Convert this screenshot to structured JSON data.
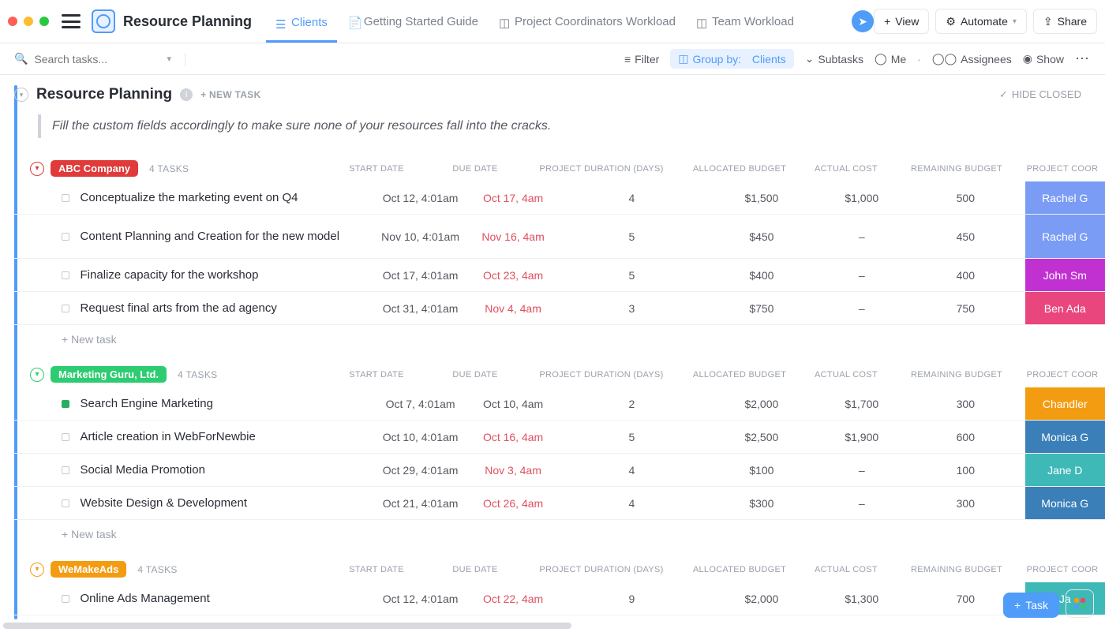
{
  "header": {
    "page_title": "Resource Planning",
    "tabs": [
      {
        "label": "Clients",
        "active": true
      },
      {
        "label": "Getting Started Guide",
        "active": false
      },
      {
        "label": "Project Coordinators Workload",
        "active": false
      },
      {
        "label": "Team Workload",
        "active": false
      }
    ],
    "add_view_label": "View",
    "automate_label": "Automate",
    "share_label": "Share"
  },
  "toolbar": {
    "search_placeholder": "Search tasks...",
    "filter_label": "Filter",
    "group_by_prefix": "Group by:",
    "group_by_value": "Clients",
    "subtasks_label": "Subtasks",
    "me_label": "Me",
    "assignees_label": "Assignees",
    "show_label": "Show"
  },
  "view": {
    "title": "Resource Planning",
    "new_task_label": "+ NEW TASK",
    "hide_closed_label": "HIDE CLOSED",
    "description": "Fill the custom fields accordingly to make sure none of your resources fall into the cracks.",
    "columns": {
      "start": "START DATE",
      "due": "DUE DATE",
      "duration": "PROJECT DURATION (DAYS)",
      "alloc": "ALLOCATED BUDGET",
      "actual": "ACTUAL COST",
      "remain": "REMAINING BUDGET",
      "coord": "PROJECT COOR"
    },
    "new_task_row": "+ New task"
  },
  "groups": [
    {
      "name": "ABC Company",
      "color": "#e03a3a",
      "count": "4 TASKS",
      "tasks": [
        {
          "name": "Conceptualize the marketing event on Q4",
          "start": "Oct 12, 4:01am",
          "due": "Oct 17, 4am",
          "due_red": true,
          "dur": "4",
          "alloc": "$1,500",
          "actual": "$1,000",
          "remain": "500",
          "coord": "Rachel G",
          "coord_color": "#7b9cf5",
          "status": "default"
        },
        {
          "name": "Content Planning and Creation for the new model",
          "start": "Nov 10, 4:01am",
          "due": "Nov 16, 4am",
          "due_red": true,
          "dur": "5",
          "alloc": "$450",
          "actual": "–",
          "remain": "450",
          "coord": "Rachel G",
          "coord_color": "#7b9cf5",
          "status": "default",
          "tall": true
        },
        {
          "name": "Finalize capacity for the workshop",
          "start": "Oct 17, 4:01am",
          "due": "Oct 23, 4am",
          "due_red": true,
          "dur": "5",
          "alloc": "$400",
          "actual": "–",
          "remain": "400",
          "coord": "John Sm",
          "coord_color": "#c131d1",
          "status": "default"
        },
        {
          "name": "Request final arts from the ad agency",
          "start": "Oct 31, 4:01am",
          "due": "Nov 4, 4am",
          "due_red": true,
          "dur": "3",
          "alloc": "$750",
          "actual": "–",
          "remain": "750",
          "coord": "Ben Ada",
          "coord_color": "#e8467c",
          "status": "default"
        }
      ]
    },
    {
      "name": "Marketing Guru, Ltd.",
      "color": "#2ecc71",
      "count": "4 TASKS",
      "tasks": [
        {
          "name": "Search Engine Marketing",
          "start": "Oct 7, 4:01am",
          "due": "Oct 10, 4am",
          "due_red": false,
          "dur": "2",
          "alloc": "$2,000",
          "actual": "$1,700",
          "remain": "300",
          "coord": "Chandler",
          "coord_color": "#f39c12",
          "status": "green"
        },
        {
          "name": "Article creation in WebForNewbie",
          "start": "Oct 10, 4:01am",
          "due": "Oct 16, 4am",
          "due_red": true,
          "dur": "5",
          "alloc": "$2,500",
          "actual": "$1,900",
          "remain": "600",
          "coord": "Monica G",
          "coord_color": "#3a7fb8",
          "status": "default"
        },
        {
          "name": "Social Media Promotion",
          "start": "Oct 29, 4:01am",
          "due": "Nov 3, 4am",
          "due_red": true,
          "dur": "4",
          "alloc": "$100",
          "actual": "–",
          "remain": "100",
          "coord": "Jane D",
          "coord_color": "#3fb8b8",
          "status": "default"
        },
        {
          "name": "Website Design & Development",
          "start": "Oct 21, 4:01am",
          "due": "Oct 26, 4am",
          "due_red": true,
          "dur": "4",
          "alloc": "$300",
          "actual": "–",
          "remain": "300",
          "coord": "Monica G",
          "coord_color": "#3a7fb8",
          "status": "default"
        }
      ]
    },
    {
      "name": "WeMakeAds",
      "color": "#f39c12",
      "count": "4 TASKS",
      "tasks": [
        {
          "name": "Online Ads Management",
          "start": "Oct 12, 4:01am",
          "due": "Oct 22, 4am",
          "due_red": true,
          "dur": "9",
          "alloc": "$2,000",
          "actual": "$1,300",
          "remain": "700",
          "coord": "Ja",
          "coord_color": "#3fb8b8",
          "status": "default"
        }
      ]
    }
  ],
  "fab": {
    "task_label": "Task"
  }
}
